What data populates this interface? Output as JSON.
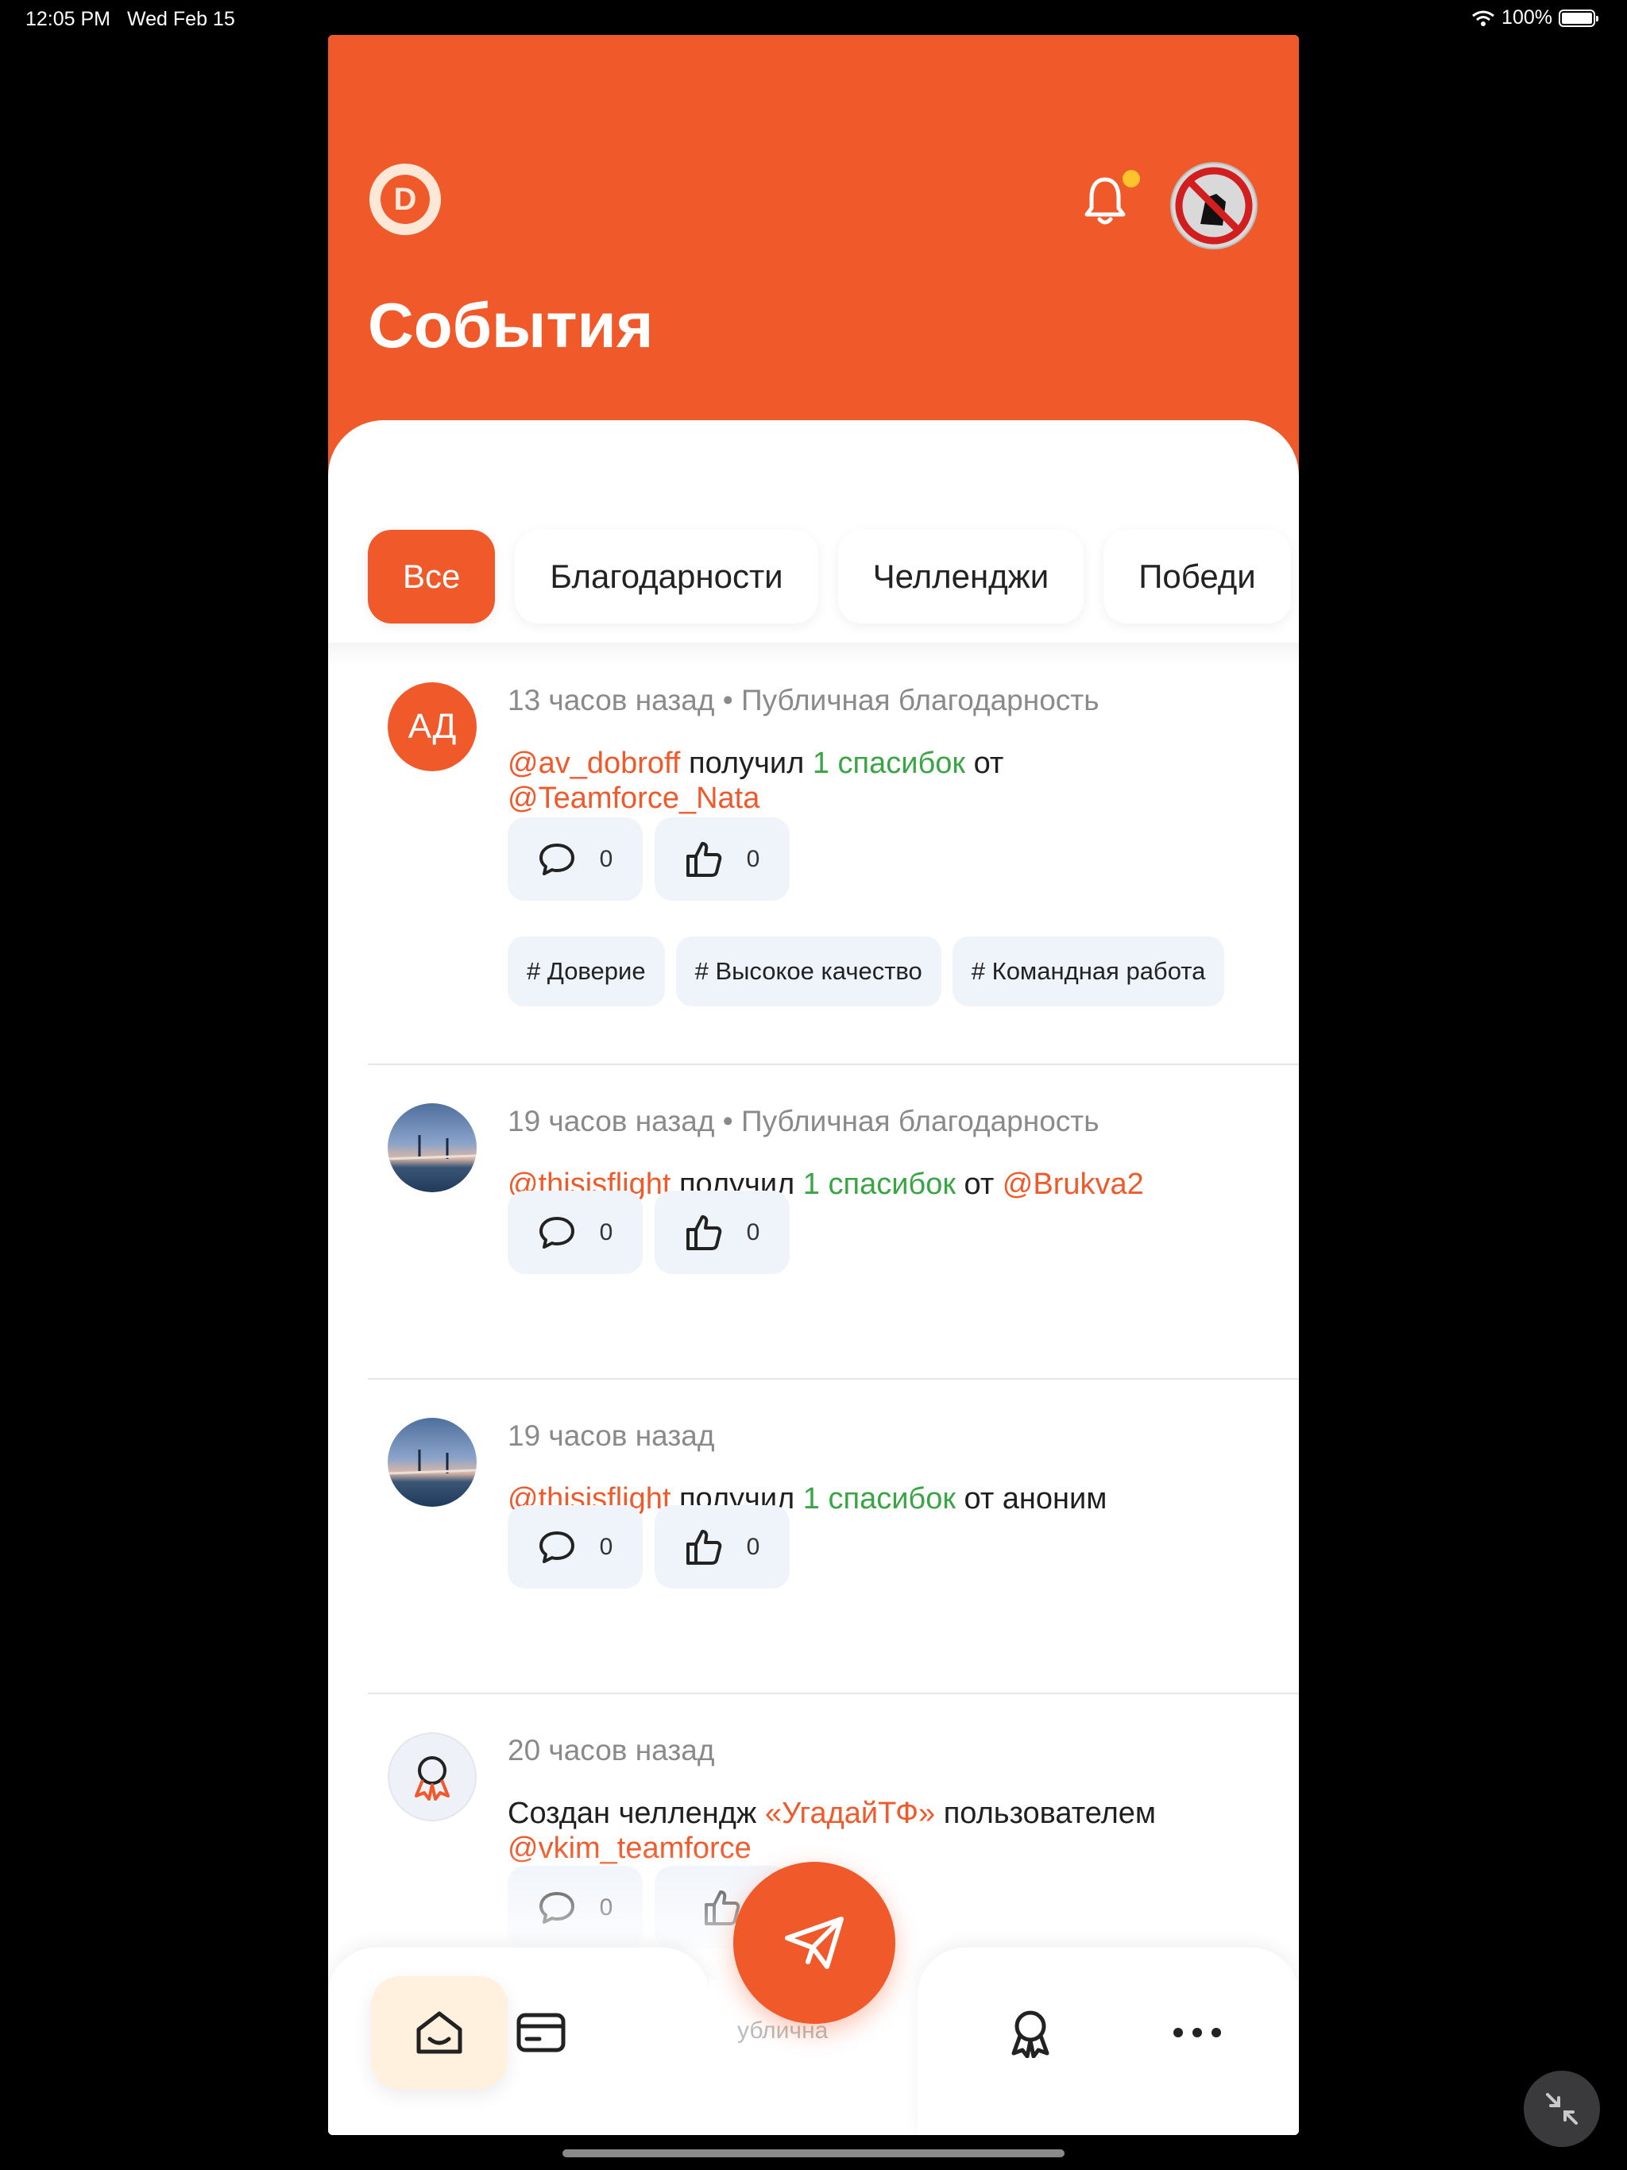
{
  "status_bar": {
    "time": "12:05 PM",
    "date": "Wed Feb 15",
    "battery": "100%",
    "battery_level": 1.0
  },
  "header": {
    "title": "События",
    "logo_letter": "D"
  },
  "filters": [
    "Все",
    "Благодарности",
    "Челленджи",
    "Победи"
  ],
  "feed": [
    {
      "avatar_initials": "АД",
      "time": "13 часов назад",
      "type": "Публичная благодарность",
      "recipient": "@av_dobroff",
      "verb": "получил",
      "amount": "1 спасибок",
      "from_word": "от",
      "sender": "@Teamforce_Nata",
      "comments": "0",
      "likes": "0",
      "tags": [
        "# Доверие",
        "# Высокое качество",
        "# Командная работа"
      ]
    },
    {
      "time": "19 часов назад",
      "type": "Публичная благодарность",
      "recipient": "@thisisflight",
      "verb": "получил",
      "amount": "1 спасибок",
      "from_word": "от",
      "sender": "@Brukva2",
      "comments": "0",
      "likes": "0"
    },
    {
      "time": "19 часов назад",
      "recipient": "@thisisflight",
      "verb": "получил",
      "amount": "1 спасибок",
      "from_word": "от аноним",
      "comments": "0",
      "likes": "0"
    },
    {
      "time": "20 часов назад",
      "prefix": "Создан челлендж",
      "challenge": "«УгадайТФ»",
      "by_word": "пользователем",
      "author": "@vkim_teamforce",
      "comments": "0"
    }
  ],
  "ghost_text": "ублична",
  "colors": {
    "accent": "#f05a2b",
    "success": "#3aa544",
    "notification_dot": "#ffc42c",
    "chip_bg": "#eff3fa"
  },
  "icons": [
    "logo-icon",
    "bell-icon",
    "comment-icon",
    "thumbs-up-icon",
    "award-icon",
    "home-icon",
    "card-icon",
    "more-icon",
    "send-icon",
    "collapse-icon",
    "wifi-icon"
  ]
}
